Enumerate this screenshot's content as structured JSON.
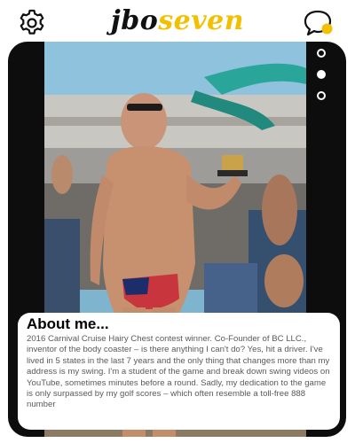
{
  "header": {
    "logo_part1": "jbo",
    "logo_part2": "seven",
    "settings_icon": "gear-icon",
    "chat_icon": "chat-notification-icon",
    "accent_color": "#f2c000"
  },
  "carousel": {
    "total": 3,
    "active_index": 1
  },
  "profile": {
    "about_heading": "About me...",
    "about_text": "2016 Carnival Cruise Hairy Chest contest winner. Co-Founder of BC LLC., inventor of the body coaster – is there anything I can't do? Yes, hit a driver. I've lived in 5 states in the last 7 years and the only thing that changes more than my address is my swing. I'm a student of the game and break down swing videos on YouTube, sometimes minutes before a round. Sadly, my dedication to the game is only surpassed by my golf scores – which often resemble a toll-free 888 number"
  }
}
